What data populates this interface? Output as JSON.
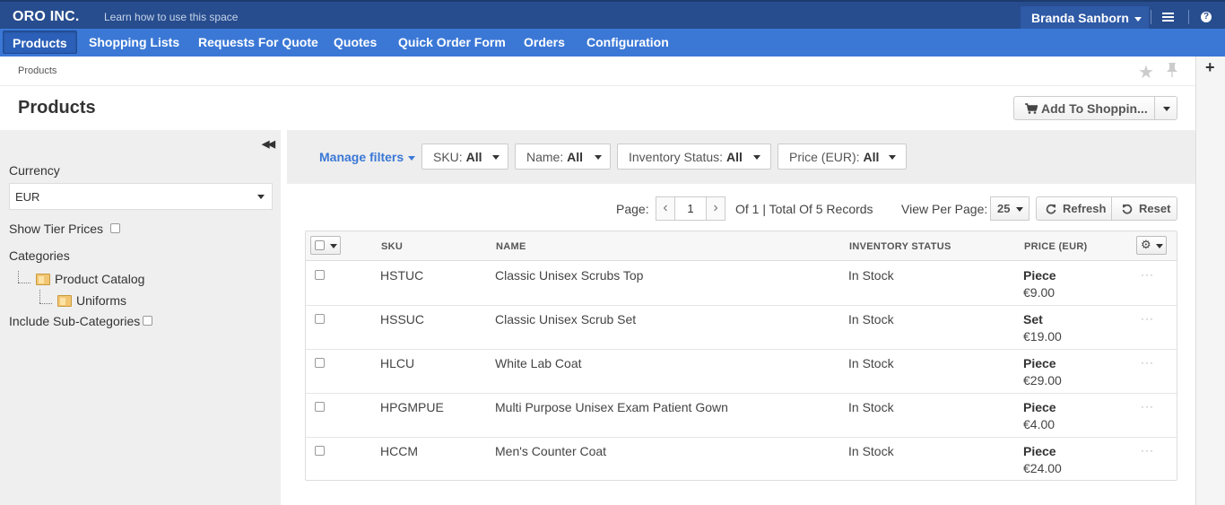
{
  "topbar": {
    "logo": "ORO INC.",
    "tagline": "Learn how to use this space",
    "user": "Branda Sanborn",
    "menu_icon": "hamburger-icon",
    "help_icon": "question-icon",
    "help_glyph": "?"
  },
  "nav": {
    "items": [
      "Products",
      "Shopping Lists",
      "Requests For Quote",
      "Quotes",
      "Quick Order Form",
      "Orders",
      "Configuration"
    ],
    "active": "Products"
  },
  "breadcrumb": "Products",
  "page_title": "Products",
  "actions": {
    "add_to_shopping": "Add To Shoppin..."
  },
  "sidebar": {
    "currency_label": "Currency",
    "currency_value": "EUR",
    "show_tier_prices": "Show Tier Prices",
    "categories_label": "Categories",
    "tree": [
      "Product Catalog",
      "Uniforms"
    ],
    "include_sub": "Include Sub-Categories"
  },
  "filters": {
    "manage": "Manage filters",
    "items": [
      {
        "label": "SKU:",
        "value": "All"
      },
      {
        "label": "Name:",
        "value": "All"
      },
      {
        "label": "Inventory Status:",
        "value": "All"
      },
      {
        "label": "Price (EUR):",
        "value": "All"
      }
    ]
  },
  "pagination": {
    "page_label": "Page:",
    "page_value": "1",
    "total": "Of 1 | Total Of 5 Records",
    "per_page_label": "View Per Page:",
    "per_page_value": "25",
    "refresh": "Refresh",
    "reset": "Reset"
  },
  "grid": {
    "columns": [
      "SKU",
      "NAME",
      "INVENTORY STATUS",
      "PRICE (EUR)"
    ],
    "rows": [
      {
        "sku": "HSTUC",
        "name": "Classic Unisex Scrubs Top",
        "status": "In Stock",
        "unit": "Piece",
        "price": "€9.00"
      },
      {
        "sku": "HSSUC",
        "name": "Classic Unisex Scrub Set",
        "status": "In Stock",
        "unit": "Set",
        "price": "€19.00"
      },
      {
        "sku": "HLCU",
        "name": "White Lab Coat",
        "status": "In Stock",
        "unit": "Piece",
        "price": "€29.00"
      },
      {
        "sku": "HPGMPUE",
        "name": "Multi Purpose Unisex Exam Patient Gown",
        "status": "In Stock",
        "unit": "Piece",
        "price": "€4.00"
      },
      {
        "sku": "HCCM",
        "name": "Men's Counter Coat",
        "status": "In Stock",
        "unit": "Piece",
        "price": "€24.00"
      }
    ],
    "row_action": "···"
  },
  "colors": {
    "topbar": "#274d8e",
    "navbar": "#3b78d6",
    "link": "#3b78d6"
  }
}
